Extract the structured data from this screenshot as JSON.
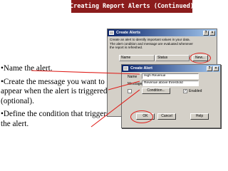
{
  "slide": {
    "title": "Creating Report Alerts (Continued)",
    "bullets": [
      "•Name the alert.",
      "•Create the message you want to appear when the alert is triggered (optional).",
      "•Define the condition that triggers the alert."
    ]
  },
  "main_window": {
    "title": "Create Alerts",
    "description": "Create an alert to identify important values in your data. The alert condition and message are evaluated whenever the report is refreshed.",
    "columns": [
      "Name",
      "Status"
    ],
    "new_button": "New..."
  },
  "alert_dialog": {
    "title": "Create Alert",
    "name_label": "Name",
    "name_value": "High Revenue",
    "message_label": "Message",
    "message_value": "Revenue above threshold",
    "condition_button": "Condition...",
    "enabled_label": "Enabled",
    "enabled_checked": true,
    "ok_button": "OK",
    "cancel_button": "Cancel",
    "help_button": "Help"
  },
  "colors": {
    "title_bar": "#8b1c1c",
    "callout": "#e0201c",
    "dialog_bg": "#d4d0c8"
  }
}
